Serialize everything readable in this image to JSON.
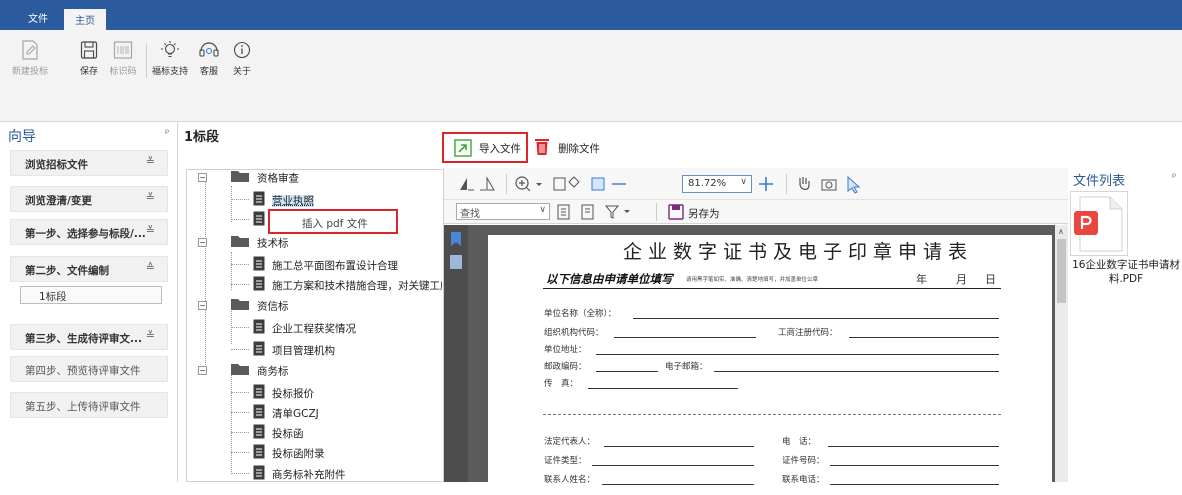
{
  "ribbon": {
    "tabs": [
      {
        "label": "文件"
      },
      {
        "label": "主页"
      }
    ],
    "buttons": {
      "new_bid": "新建投标",
      "save": "保存",
      "tag_code": "标识码",
      "support": "福标支持",
      "service": "客服",
      "about": "关于"
    }
  },
  "nav": {
    "title": "向导",
    "pin": "ᵖ",
    "sections": [
      {
        "label": "浏览招标文件",
        "chevron": "≚"
      },
      {
        "label": "浏览澄清/变更",
        "chevron": "≚"
      },
      {
        "label": "第一步、选择参与标段/...",
        "chevron": "≚"
      },
      {
        "label": "第二步、文件编制",
        "chevron": "≙"
      },
      {
        "label": "第三步、生成待评审文...",
        "chevron": "≚"
      },
      {
        "label": "第四步、预览待评审文件",
        "chevron": ""
      },
      {
        "label": "第五步、上传待评审文件",
        "chevron": ""
      }
    ],
    "sub_item": "1标段"
  },
  "tree": {
    "title": "1标段",
    "context_menu": "插入 pdf 文件",
    "nodes": [
      {
        "label": "资格审查"
      },
      {
        "label": "营业执照"
      },
      {
        "label": ""
      },
      {
        "label": "技术标"
      },
      {
        "label": "施工总平面图布置设计合理"
      },
      {
        "label": "施工方案和技术措施合理，对关键工序"
      },
      {
        "label": "资信标"
      },
      {
        "label": "企业工程获奖情况"
      },
      {
        "label": "项目管理机构"
      },
      {
        "label": "商务标"
      },
      {
        "label": "投标报价"
      },
      {
        "label": "清单GCZJ"
      },
      {
        "label": "投标函"
      },
      {
        "label": "投标函附录"
      },
      {
        "label": "商务标补充附件"
      }
    ]
  },
  "doc_actions": {
    "import": "导入文件",
    "delete": "删除文件"
  },
  "viewer": {
    "zoom": "81.72%",
    "search_placeholder": "查找",
    "save_as": "另存为"
  },
  "form": {
    "title": "企业数字证书及电子印章申请表",
    "subtitle": "以下信息由申请单位填写",
    "subtitle_note": "请用黑字笔如实、准确、清楚地填写，并加盖单位公章",
    "year": "年",
    "month": "月",
    "day": "日",
    "fields": {
      "unit_name": "单位名称（全称）：",
      "org_code": "组织机构代码：",
      "biz_reg": "工商注册代码：",
      "address": "单位地址：",
      "postcode": "邮政编码：",
      "email": "电子邮箱：",
      "fax": "传　真：",
      "legal_rep": "法定代表人：",
      "phone": "电　话：",
      "cert_type": "证件类型：",
      "cert_no": "证件号码：",
      "contact_name": "联系人姓名：",
      "contact_phone": "联系电话："
    }
  },
  "file_list": {
    "title": "文件列表",
    "pin": "ᵖ",
    "files": [
      {
        "name": "16企业数字证书申请材料.PDF"
      }
    ]
  },
  "colors": {
    "title_bar": "#2c5a9e",
    "highlight_red": "#d9262b",
    "import_green": "#3aa935",
    "pdf_red": "#e8473f"
  }
}
